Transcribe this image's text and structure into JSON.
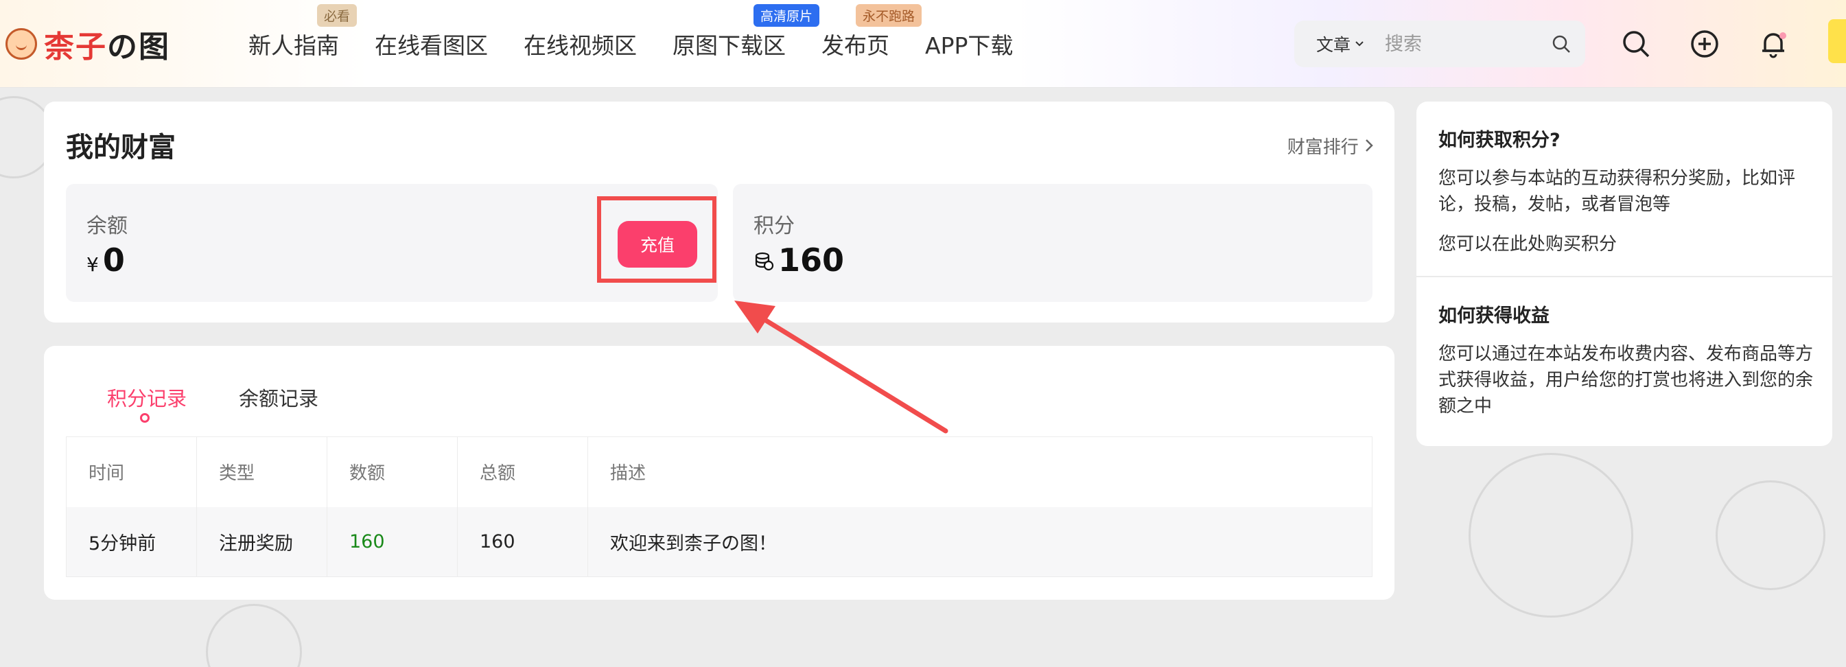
{
  "header": {
    "logo": {
      "text_red": "柰子",
      "text_dark": "の图"
    },
    "nav": [
      {
        "label": "新人指南",
        "badge": "必看"
      },
      {
        "label": "在线看图区",
        "badge": null
      },
      {
        "label": "在线视频区",
        "badge": null
      },
      {
        "label": "原图下载区",
        "badge": "高清原片"
      },
      {
        "label": "发布页",
        "badge": "永不跑路"
      },
      {
        "label": "APP下载",
        "badge": null
      }
    ],
    "search": {
      "category": "文章",
      "placeholder": "搜索"
    },
    "icons": [
      "search-icon",
      "plus-circle-icon",
      "bell-icon"
    ]
  },
  "wealth": {
    "title": "我的财富",
    "rank_link": "财富排行",
    "balance": {
      "label": "余额",
      "currency": "¥",
      "value": "0",
      "button": "充值"
    },
    "points": {
      "label": "积分",
      "value": "160"
    }
  },
  "records": {
    "tabs": [
      "积分记录",
      "余额记录"
    ],
    "active_tab": "积分记录",
    "columns": [
      "时间",
      "类型",
      "数额",
      "总额",
      "描述"
    ],
    "rows": [
      {
        "time": "5分钟前",
        "type": "注册奖励",
        "amount": "160",
        "total": "160",
        "desc": "欢迎来到柰子の图！"
      }
    ]
  },
  "sidebar": {
    "earn_points": {
      "title": "如何获取积分?",
      "text": "您可以参与本站的互动获得积分奖励，比如评论，投稿，发帖，或者冒泡等",
      "text2": "您可以在此处购买积分"
    },
    "earn_income": {
      "title": "如何获得收益",
      "text": "您可以通过在本站发布收费内容、发布商品等方式获得收益，用户给您的打赏也将进入到您的余额之中"
    }
  },
  "colors": {
    "accent": "#fb3f6c",
    "annotation": "#f14c4c",
    "positive": "#1a8a1a"
  }
}
